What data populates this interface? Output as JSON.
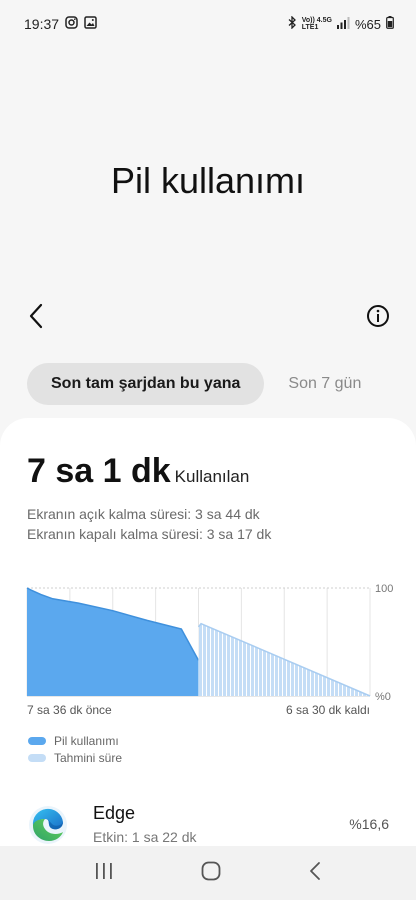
{
  "status_bar": {
    "time": "19:37",
    "network_top": "Vo)) 4.5G",
    "network_bottom": "LTE1",
    "battery": "%65",
    "icons": [
      "instagram-icon",
      "gallery-icon",
      "bluetooth-icon",
      "signal-icon",
      "battery-icon"
    ]
  },
  "page": {
    "title": "Pil kullanımı"
  },
  "tabs": [
    {
      "label": "Son tam şarjdan bu yana",
      "active": true
    },
    {
      "label": "Son 7 gün",
      "active": false
    }
  ],
  "summary": {
    "usage_value": "7 sa 1 dk",
    "usage_suffix": "Kullanılan",
    "screen_on": "Ekranın açık kalma süresi: 3 sa 44 dk",
    "screen_off": "Ekranın kapalı kalma süresi: 3 sa 17 dk"
  },
  "chart_data": {
    "type": "area",
    "y_labels": [
      "100",
      "%0"
    ],
    "ylim": [
      0,
      100
    ],
    "x_label_left": "7 sa 36 dk önce",
    "x_label_right": "6 sa 30 dk kaldı",
    "series": [
      {
        "name": "Pil kullanımı",
        "x": [
          0,
          2.5,
          8,
          15,
          30,
          50,
          70,
          90,
          100
        ],
        "y": [
          100,
          98,
          94,
          90,
          86,
          79,
          70,
          62,
          33
        ],
        "color": "#5ba8ee"
      },
      {
        "name": "Tahmini süre",
        "x": [
          100,
          101.5,
          200
        ],
        "y": [
          64,
          67,
          0
        ],
        "color": "#c4ddf6"
      }
    ],
    "x_domain": [
      0,
      200
    ],
    "grid": true,
    "legend_placement": "bottom-left"
  },
  "apps": [
    {
      "name": "Edge",
      "active": "Etkin: 1 sa 22 dk",
      "percent": "%16,6"
    }
  ],
  "colors": {
    "accent": "#5ba8ee",
    "forecast": "#c4ddf6",
    "card": "#ffffff",
    "bg": "#f6f6f6"
  }
}
